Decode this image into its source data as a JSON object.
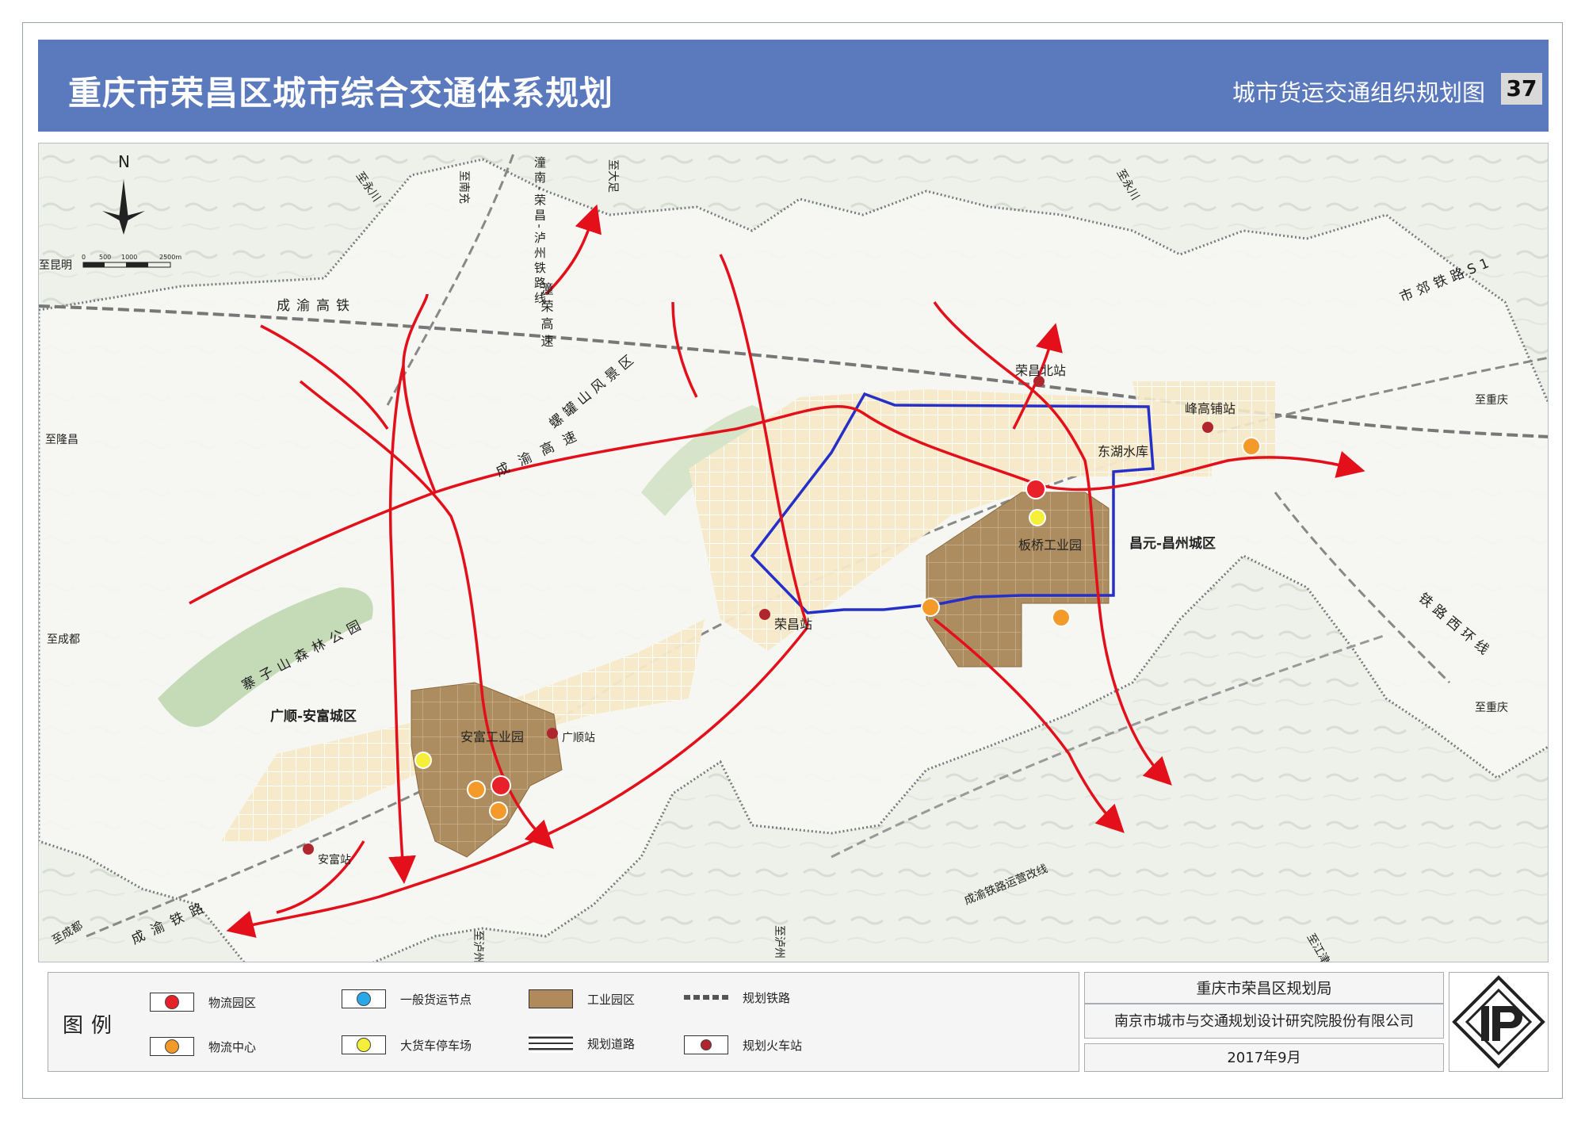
{
  "header": {
    "title": "重庆市荣昌区城市综合交通体系规划",
    "subtitle": "城市货运交通组织规划图",
    "page_number": "37"
  },
  "map": {
    "north_label": "N",
    "scale_labels": [
      "0",
      "500",
      "1000",
      "2500m"
    ],
    "direction_labels": {
      "to_yongchuan_top": "至永川",
      "to_nanchong": "至南充",
      "to_dazu": "至大足",
      "to_yongchuan_ne": "至永川",
      "to_chongqing_1": "至重庆",
      "to_chongqing_2": "至重庆",
      "to_longchang": "至隆昌",
      "to_chengdu_1": "至成都",
      "to_chengdu_2": "至成都",
      "to_luzhou_1": "至泸州",
      "to_luzhou_2": "至泸州",
      "to_jiangjin": "至江津",
      "to_left_top": "至昆明"
    },
    "corridor_labels": {
      "chengyu_hsr": "成渝高铁",
      "tongnan_rail": "潼南-荣昌-泸州铁路线",
      "tongrong_expwy": "潼荣高速",
      "chengyu_expwy": "成渝高速",
      "luoguan_scenic": "螺罐山风景区",
      "shijiao_rail": "市郊铁路S1",
      "rail_west_ring": "铁路西环线",
      "chengyu_rail": "成渝铁路",
      "chengyu_rail_realign": "成渝铁路运营改线",
      "zhaizishan_park": "寨子山森林公园"
    },
    "place_labels": {
      "rongchang_north": "荣昌北站",
      "fenggaopu": "峰高铺站",
      "donghu": "东湖水库",
      "banqiao": "板桥工业园",
      "changyuan": "昌元-昌州城区",
      "rongchang_station": "荣昌站",
      "guangshun_anfu": "广顺-安富城区",
      "anfu_park": "安富工业园",
      "guangshun_station": "广顺站",
      "anfu_station": "安富站"
    }
  },
  "legend": {
    "title": "图例",
    "items": [
      {
        "label": "物流园区",
        "color": "#e8202a"
      },
      {
        "label": "物流中心",
        "color": "#f39a2b"
      },
      {
        "label": "一般货运节点",
        "color": "#2aa7e8"
      },
      {
        "label": "大货车停车场",
        "color": "#f5ef3a"
      },
      {
        "label": "工业园区",
        "color": "#b08a5a"
      },
      {
        "label": "规划道路",
        "color": "#333333"
      },
      {
        "label": "规划铁路",
        "color": "#555555"
      },
      {
        "label": "规划火车站",
        "color": "#b0262e"
      }
    ]
  },
  "credits": {
    "client": "重庆市荣昌区规划局",
    "designer": "南京市城市与交通规划设计研究院股份有限公司",
    "date": "2017年9月"
  },
  "colors": {
    "banner": "#5b79bd",
    "freight_route": "#e3101b",
    "cordon": "#2630c8",
    "industrial": "#a8885c"
  }
}
